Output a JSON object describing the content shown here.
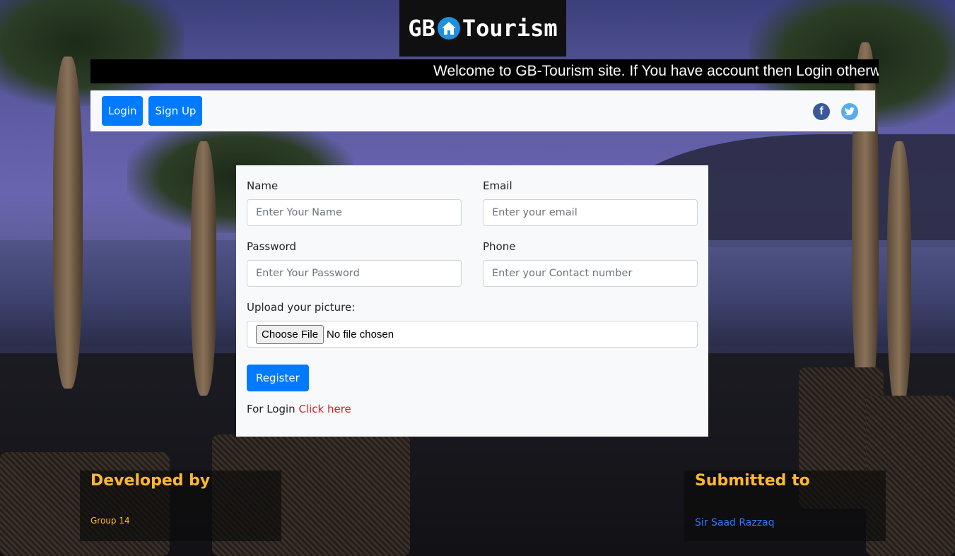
{
  "logo": {
    "text_left": "GB",
    "text_right": "Tourism",
    "icon": "house-icon"
  },
  "marquee": {
    "text": "Welcome to GB-Tourism site. If You have account then Login otherwise Sign Up"
  },
  "navbar": {
    "login_label": "Login",
    "signup_label": "Sign Up",
    "social": [
      {
        "name": "facebook-icon",
        "glyph": "f",
        "color": "#3b5998"
      },
      {
        "name": "twitter-icon",
        "glyph": "t",
        "color": "#55acee"
      }
    ]
  },
  "form": {
    "name_label": "Name",
    "name_placeholder": "Enter Your Name",
    "email_label": "Email",
    "email_placeholder": "Enter your email",
    "password_label": "Password",
    "password_placeholder": "Enter Your Password",
    "phone_label": "Phone",
    "phone_placeholder": "Enter your Contact number",
    "picture_label": "Upload your picture:",
    "file_button": "Choose File",
    "file_status": "No file chosen",
    "register_label": "Register",
    "login_prompt": "For Login",
    "login_link": "Click here"
  },
  "footer": {
    "developed_title": "Developed by",
    "developed_value": "Group 14",
    "submitted_title": "Submitted to",
    "submitted_value": "Sir Saad Razzaq"
  },
  "colors": {
    "primary": "#007bff",
    "footer_heading": "#ffb82e",
    "link_red": "#dc1e1e",
    "link_blue": "#2f7bff"
  }
}
